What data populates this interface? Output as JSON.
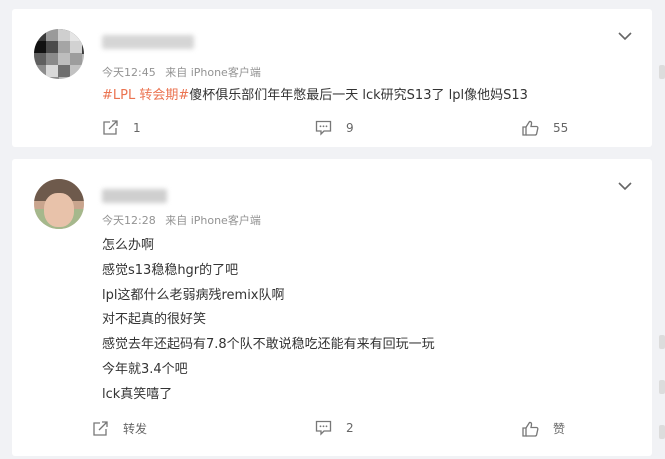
{
  "posts": [
    {
      "meta": {
        "time": "今天12:45",
        "source": "来自 iPhone客户端"
      },
      "topic": "#LPL 转会期#",
      "text": "傻杯俱乐部们年年憋最后一天 lck研究S13了 lpl像他妈S13",
      "actions": {
        "repost": "1",
        "comment": "9",
        "like": "55"
      }
    },
    {
      "meta": {
        "time": "今天12:28",
        "source": "来自 iPhone客户端"
      },
      "lines": [
        "怎么办啊",
        "感觉s13稳稳hgr的了吧",
        "lpl这都什么老弱病残remix队啊",
        "对不起真的很好笑",
        "感觉去年还起码有7.8个队不敢说稳吃还能有来有回玩一玩",
        "今年就3.4个吧",
        "lck真笑嘻了"
      ],
      "actions": {
        "repost": "转发",
        "comment": "2",
        "like": "赞"
      }
    }
  ],
  "icons": [
    "chevron-down-icon",
    "repost-icon",
    "comment-icon",
    "like-icon"
  ],
  "colors": {
    "topic": "#eb7350",
    "meta": "#939393",
    "background": "#f1f2f5"
  }
}
